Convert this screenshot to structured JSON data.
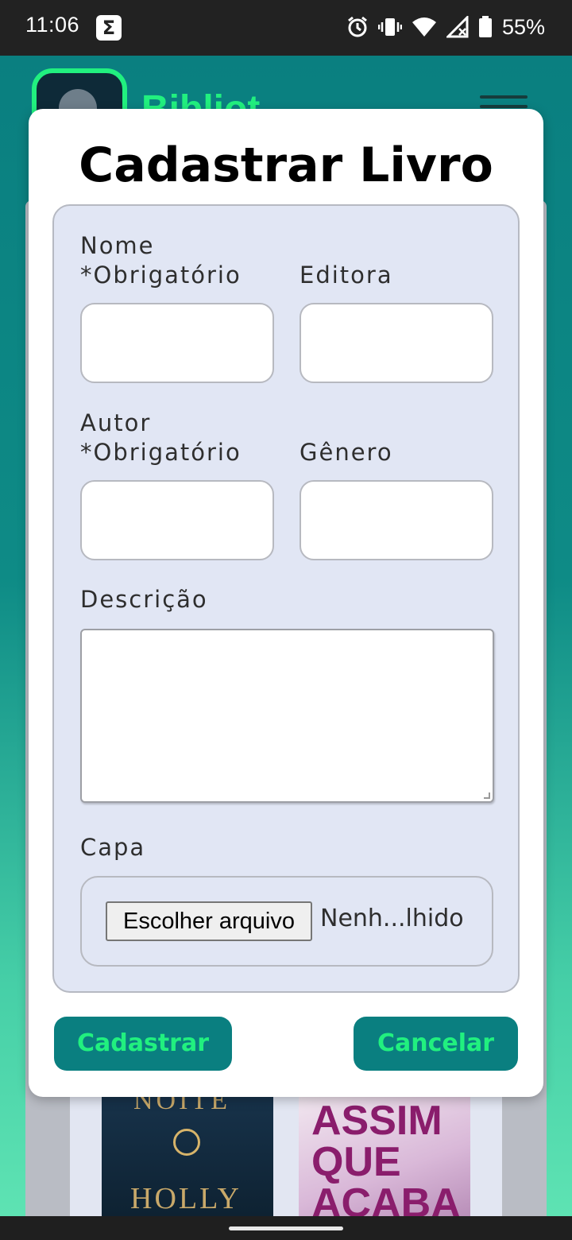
{
  "status_bar": {
    "time": "11:06",
    "sigma_glyph": "Σ",
    "icons": [
      "alarm-icon",
      "vibrate-icon",
      "wifi-icon",
      "signal-icon",
      "battery-icon"
    ],
    "battery": "55%"
  },
  "background_app": {
    "title": "Bibliot",
    "book_covers": [
      {
        "top_text": "NOITE",
        "bottom_text": "HOLLY"
      },
      {
        "text": "ASSIM QUE ACABA"
      }
    ]
  },
  "modal": {
    "title": "Cadastrar Livro",
    "fields": {
      "nome": {
        "label_line1": "Nome",
        "label_line2": "*Obrigatório",
        "value": ""
      },
      "editora": {
        "label": "Editora",
        "value": ""
      },
      "autor": {
        "label_line1": "Autor",
        "label_line2": "*Obrigatório",
        "value": ""
      },
      "genero": {
        "label": "Gênero",
        "value": ""
      },
      "descricao": {
        "label": "Descrição",
        "value": ""
      },
      "capa": {
        "label": "Capa",
        "button_label": "Escolher arquivo",
        "file_status": "Nenh...lhido"
      }
    },
    "buttons": {
      "submit": "Cadastrar",
      "cancel": "Cancelar"
    }
  },
  "colors": {
    "accent_teal": "#0a7f80",
    "accent_green": "#21f07f",
    "form_bg": "#e1e6f4"
  }
}
